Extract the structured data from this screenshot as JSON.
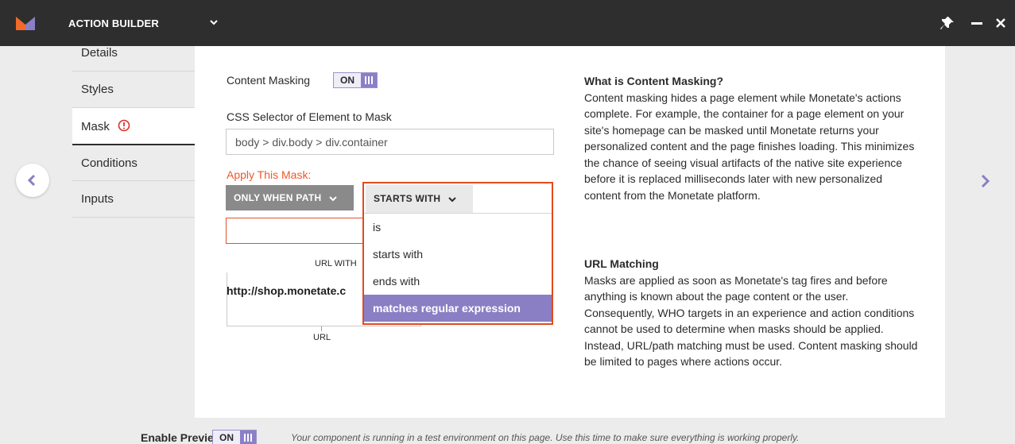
{
  "header": {
    "title": "ACTION BUILDER"
  },
  "tabs": [
    {
      "label": "Details"
    },
    {
      "label": "Styles"
    },
    {
      "label": "Mask"
    },
    {
      "label": "Conditions"
    },
    {
      "label": "Inputs"
    }
  ],
  "form": {
    "content_masking_label": "Content Masking",
    "content_masking_toggle": "ON",
    "css_selector_label": "CSS Selector of Element to Mask",
    "css_selector_value": "body > div.body > div.container",
    "apply_mask_label": "Apply This Mask:",
    "path_button_label": "ONLY WHEN PATH",
    "match_button_label": "STARTS WITH",
    "url_with_label": "URL WITH",
    "url_value": "http://shop.monetate.c",
    "url_axis_label": "URL"
  },
  "dropdown": {
    "options": [
      "is",
      "starts with",
      "ends with",
      "matches regular expression"
    ],
    "selected": "matches regular expression"
  },
  "help": {
    "heading1": "What is Content Masking?",
    "body1": "Content masking hides a page element while Monetate's actions complete. For example, the container for a page element on your site's homepage can be masked until Monetate returns your personalized content and the page finishes loading. This minimizes the chance of seeing visual artifacts of the native site experience before it is replaced milliseconds later with new personalized content from the Monetate platform.",
    "heading2": "URL Matching",
    "body2": "Masks are applied as soon as Monetate's tag fires and before anything is known about the page content or the user. Consequently, WHO targets in an experience and action conditions cannot be used to determine when masks should be applied. Instead, URL/path matching must be used. Content masking should be limited to pages where actions occur."
  },
  "footer": {
    "enable_preview_label": "Enable Preview",
    "toggle_label": "ON",
    "note": "Your component is running in a test environment on this page. Use this time to make sure everything is working properly."
  },
  "colors": {
    "topbar": "#2e2e2e",
    "accent": "#8a7fc4",
    "alert": "#f0582a",
    "highlight_border": "#e24a1f"
  }
}
